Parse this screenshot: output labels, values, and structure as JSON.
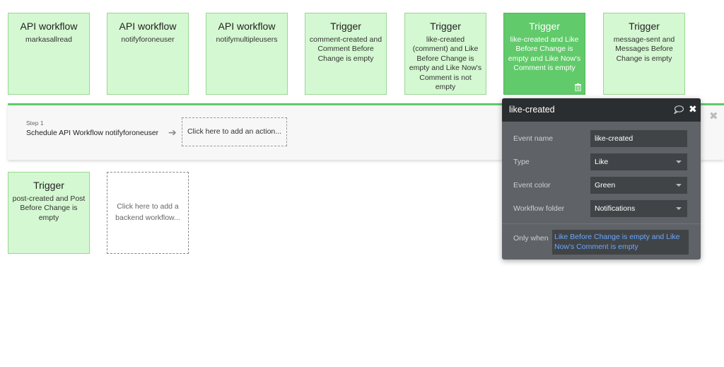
{
  "cards": [
    {
      "title": "API workflow",
      "subtitle": "markasallread"
    },
    {
      "title": "API workflow",
      "subtitle": "notifyforoneuser"
    },
    {
      "title": "API workflow",
      "subtitle": "notifymultipleusers"
    },
    {
      "title": "Trigger",
      "subtitle": "comment-created and Comment Before Change is empty"
    },
    {
      "title": "Trigger",
      "subtitle": "like-created (comment) and Like Before Change is empty and Like Now's Comment is not empty"
    },
    {
      "title": "Trigger",
      "subtitle": "like-created and Like Before Change is empty and Like Now's Comment is empty"
    },
    {
      "title": "Trigger",
      "subtitle": "message-sent and Messages Before Change is empty"
    },
    {
      "title": "Trigger",
      "subtitle": "post-created and Post Before Change is empty"
    }
  ],
  "add_workflow": "Click here to add a backend workflow...",
  "step": {
    "label": "Step 1",
    "name": "Schedule API Workflow notifyforoneuser",
    "add_action": "Click here to add an action..."
  },
  "panel": {
    "title": "like-created",
    "event_name_label": "Event name",
    "event_name_value": "like-created",
    "type_label": "Type",
    "type_value": "Like",
    "color_label": "Event color",
    "color_value": "Green",
    "folder_label": "Workflow folder",
    "folder_value": "Notifications",
    "only_when_label": "Only when",
    "only_when_value": "Like Before Change is empty and Like Now's Comment is empty"
  },
  "colors": {
    "card_bg": "#d4f8d1",
    "card_active_bg": "#61ca6a",
    "panel_bg": "#5f6266",
    "panel_header": "#2b2e31",
    "condition_text": "#6aa8ff"
  }
}
